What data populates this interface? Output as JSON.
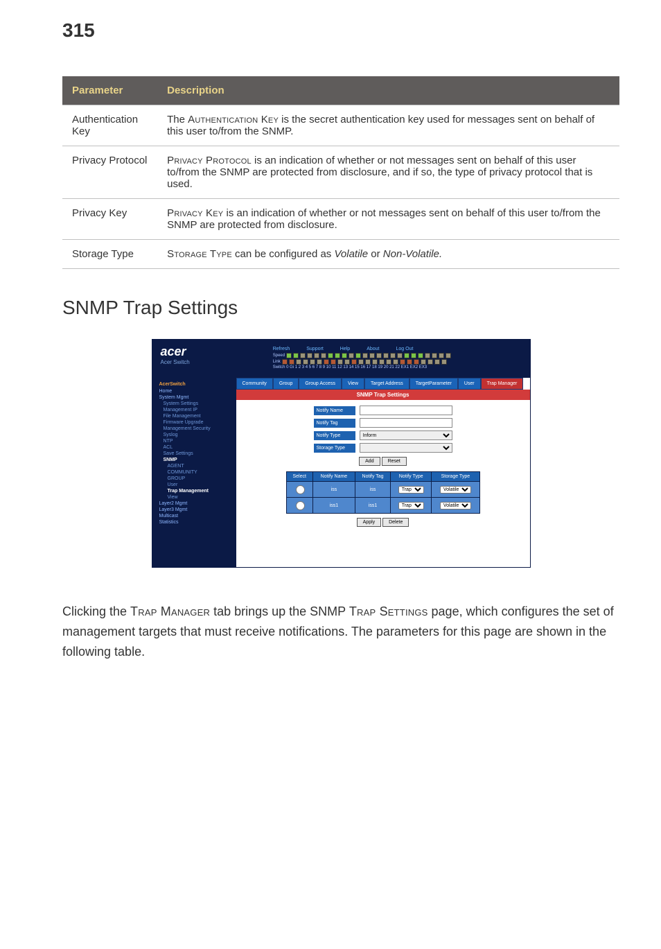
{
  "page_number": "315",
  "param_table": {
    "headers": {
      "parameter": "Parameter",
      "description": "Description"
    },
    "rows": [
      {
        "param": "Authentication Key",
        "desc_pre": "The ",
        "desc_sc": "Authentication Key",
        "desc_post": " is the secret authentication key used for messages sent on behalf of this user to/from the SNMP."
      },
      {
        "param": "Privacy Protocol",
        "desc_pre": "",
        "desc_sc": "Privacy Protocol",
        "desc_post": " is an indication of whether or not messages sent on behalf of this user to/from the SNMP are protected from disclosure, and if so, the type of privacy protocol that is used."
      },
      {
        "param": "Privacy Key",
        "desc_pre": "",
        "desc_sc": "Privacy Key",
        "desc_post": " is an indication of whether or not messages sent on behalf of this user to/from the SNMP are protected from disclosure."
      },
      {
        "param": "Storage Type",
        "desc_pre": "",
        "desc_sc": "Storage Type",
        "desc_post": " can be configured as ",
        "desc_it1": "Volatile",
        "desc_mid": " or ",
        "desc_it2": "Non-Volatile.",
        "desc_end": ""
      }
    ]
  },
  "section_heading": "SNMP Trap Settings",
  "screenshot": {
    "brand": "acer",
    "brand_sub": "Acer Switch",
    "top_links": [
      "Refresh",
      "Support",
      "Help",
      "About",
      "Log Out"
    ],
    "speed_label": "Speed",
    "link_label": "Link",
    "switch_label": "Switch 0 Gi 1 2 3 4 5 6 7 8 9 10 11 12 13 14 15 16 17 18 19 20 21 22 EX1 EX2 EX3",
    "sidebar_header": "AcerSwitch",
    "sidebar": {
      "home": "Home",
      "system_mgmt": "System Mgmt",
      "items1": [
        "System Settings",
        "Management IP",
        "File Management",
        "Firmware Upgrade",
        "Management Security",
        "Syslog",
        "NTP",
        "ACL",
        "Save Settings"
      ],
      "snmp": "SNMP",
      "snmp_items": [
        "AGENT",
        "COMMUNITY",
        "GROUP",
        "User",
        "Trap Management",
        "View"
      ],
      "items2": [
        "Layer2 Mgmt",
        "Layer3 Mgmt",
        "Multicast",
        "Statistics"
      ]
    },
    "tabs": [
      "Community",
      "Group",
      "Group Access",
      "View",
      "Target Address",
      "TargetParameter",
      "User",
      "Trap Manager"
    ],
    "panel_title": "SNMP Trap Settings",
    "form": {
      "notify_name_label": "Notify Name",
      "notify_tag_label": "Notify Tag",
      "notify_type_label": "Notify Type",
      "notify_type_value": "Inform",
      "storage_type_label": "Storage Type",
      "add_btn": "Add",
      "reset_btn": "Reset"
    },
    "grid": {
      "headers": [
        "Select",
        "Notify Name",
        "Notify Tag",
        "Notify Type",
        "Storage Type"
      ],
      "rows": [
        {
          "name": "iss",
          "tag": "iss",
          "type": "Trap",
          "storage": "Volatile"
        },
        {
          "name": "iss1",
          "tag": "iss1",
          "type": "Trap",
          "storage": "Volatile"
        }
      ],
      "apply_btn": "Apply",
      "delete_btn": "Delete"
    }
  },
  "body_paragraph": {
    "pre1": "Clicking the ",
    "sc1": "Trap Manager",
    "mid1": " tab brings up the SNMP ",
    "sc2": "Trap Settings",
    "post1": " page, which configures the set of management targets that must receive notifications. The parameters for this page are shown in the following table."
  }
}
